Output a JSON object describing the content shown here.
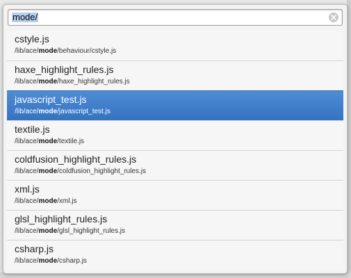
{
  "search": {
    "value": "mode/"
  },
  "results": [
    {
      "name": "cstyle.js",
      "path_prefix": "/lib/ace/",
      "path_match": "mode",
      "path_suffix": "/behaviour/cstyle.js",
      "selected": false
    },
    {
      "name": "haxe_highlight_rules.js",
      "path_prefix": "/lib/ace/",
      "path_match": "mode",
      "path_suffix": "/haxe_highlight_rules.js",
      "selected": false
    },
    {
      "name": "javascript_test.js",
      "path_prefix": "/lib/ace/",
      "path_match": "mode",
      "path_suffix": "/javascript_test.js",
      "selected": true
    },
    {
      "name": "textile.js",
      "path_prefix": "/lib/ace/",
      "path_match": "mode",
      "path_suffix": "/textile.js",
      "selected": false
    },
    {
      "name": "coldfusion_highlight_rules.js",
      "path_prefix": "/lib/ace/",
      "path_match": "mode",
      "path_suffix": "/coldfusion_highlight_rules.js",
      "selected": false
    },
    {
      "name": "xml.js",
      "path_prefix": "/lib/ace/",
      "path_match": "mode",
      "path_suffix": "/xml.js",
      "selected": false
    },
    {
      "name": "glsl_highlight_rules.js",
      "path_prefix": "/lib/ace/",
      "path_match": "mode",
      "path_suffix": "/glsl_highlight_rules.js",
      "selected": false
    },
    {
      "name": "csharp.js",
      "path_prefix": "/lib/ace/",
      "path_match": "mode",
      "path_suffix": "/csharp.js",
      "selected": false
    }
  ],
  "icons": {
    "clear": "clear-search-icon"
  },
  "colors": {
    "selection_highlight": "#3d7cc9",
    "text_selection": "#b6d0f0"
  }
}
